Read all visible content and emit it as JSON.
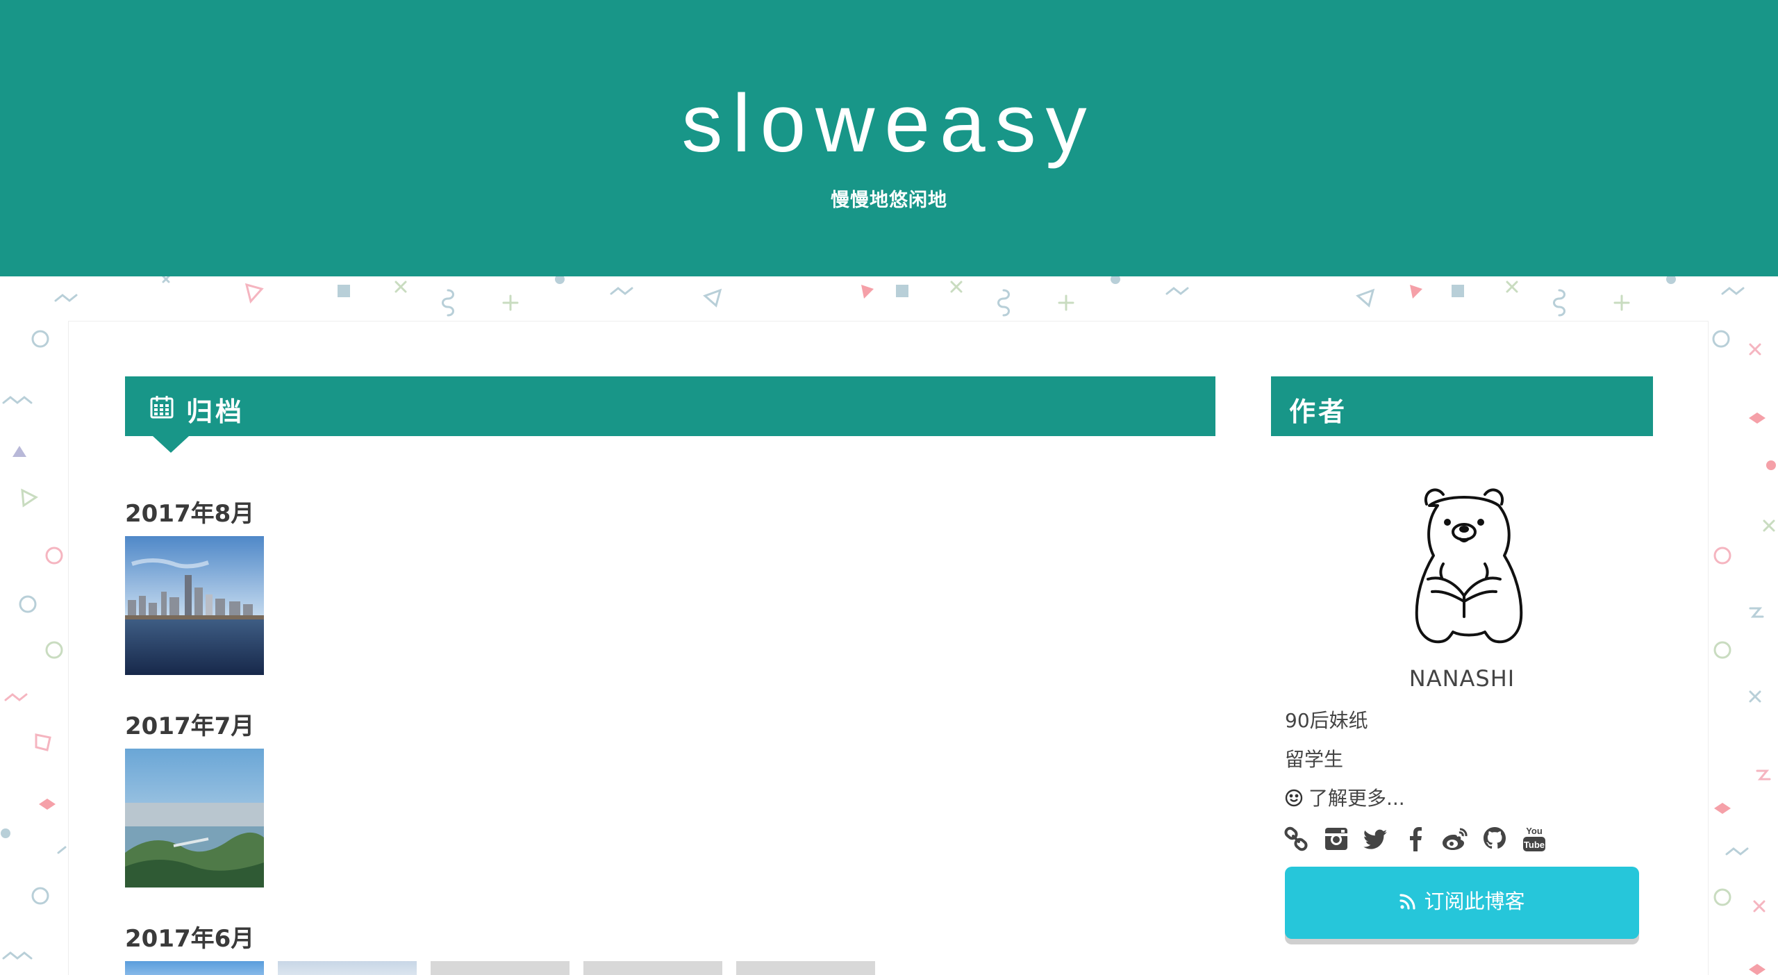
{
  "site": {
    "title": "sloweasy",
    "subtitle": "慢慢地悠闲地"
  },
  "archive": {
    "heading": "归档",
    "months": [
      {
        "label": "2017年8月"
      },
      {
        "label": "2017年7月"
      },
      {
        "label": "2017年6月"
      }
    ]
  },
  "author": {
    "heading": "作者",
    "name": "NANASHI",
    "bio_lines": [
      "90后妹纸",
      "留学生"
    ],
    "more_link": "了解更多...",
    "social_icons": [
      "link-icon",
      "instagram-icon",
      "twitter-icon",
      "facebook-icon",
      "weibo-icon",
      "github-icon",
      "youtube-icon"
    ],
    "youtube_text_top": "You",
    "youtube_text_bottom": "Tube",
    "subscribe_label": "订阅此博客"
  },
  "colors": {
    "brand": "#189688",
    "subscribe": "#26c6da",
    "text": "#333333"
  }
}
